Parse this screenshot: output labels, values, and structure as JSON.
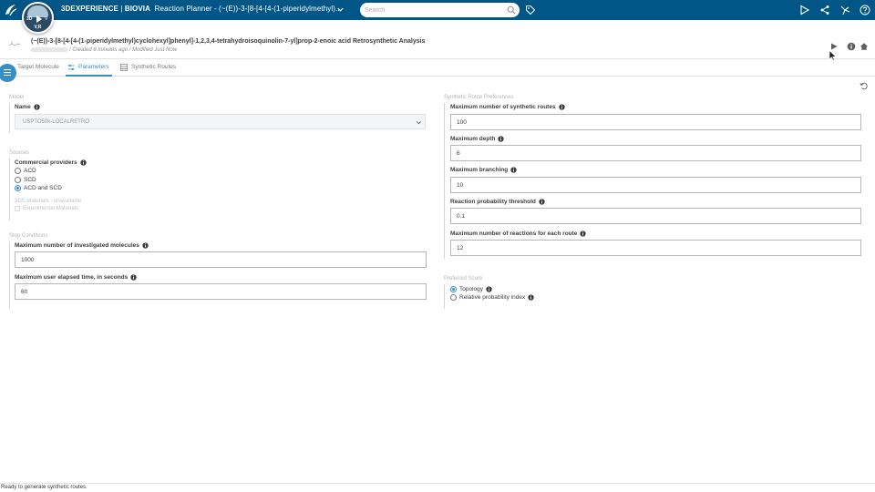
{
  "topbar": {
    "brand": "3DEXPERIENCE",
    "divider": " | ",
    "brand_app": "BIOVIA",
    "app_title": "Reaction Planner - (~(E))-3-[8-[4-[4-(1-piperidylmethyl)...",
    "search_placeholder": "Search",
    "compass_3d": "3D",
    "compass_v": "V",
    "compass_ver": "V,R"
  },
  "header": {
    "title": "(~(E))-3-[8-[4-[4-(1-piperidylmethyl)cyclohexyl]phenyl]-1,2,3,4-tetrahydroisoquinolin-7-yl]prop-2-enoic acid Retrosynthetic Analysis",
    "meta": "/ Created 8 minutes ago / Modified Just Now"
  },
  "tabs": [
    {
      "label": "Target Molecule"
    },
    {
      "label": "Parameters"
    },
    {
      "label": "Synthetic Routes"
    }
  ],
  "model": {
    "section": "Model",
    "name_label": "Name",
    "name_value": "USPTO50k-LOCALRETRO"
  },
  "sources": {
    "section": "Sources",
    "providers_label": "Commercial providers",
    "options": [
      "ACD",
      "SCD",
      "ACD and SCD"
    ],
    "selected": 2,
    "unavailable": "3DS Materials - unavailable",
    "experimental": "Experimental Materials"
  },
  "stop": {
    "section": "Stop Conditions",
    "max_molecules_label": "Maximum number of investigated molecules",
    "max_molecules_value": "1000",
    "max_time_label": "Maximum user elapsed time, in seconds",
    "max_time_value": "60"
  },
  "route_prefs": {
    "section": "Synthetic Route Preferences",
    "fields": [
      {
        "label": "Maximum number of synthetic routes",
        "value": "100"
      },
      {
        "label": "Maximum depth",
        "value": "6"
      },
      {
        "label": "Maximum branching",
        "value": "10"
      },
      {
        "label": "Reaction probability threshold",
        "value": "0.1"
      },
      {
        "label": "Maximum number of reactions for each route",
        "value": "12"
      }
    ]
  },
  "score": {
    "section": "Preferred Score",
    "options": [
      "Topology",
      "Relative probability index"
    ],
    "selected": 0
  },
  "status": "Ready to generate synthetic routes.",
  "colors": {
    "topbar": "#005686",
    "accent": "#368ec4"
  }
}
